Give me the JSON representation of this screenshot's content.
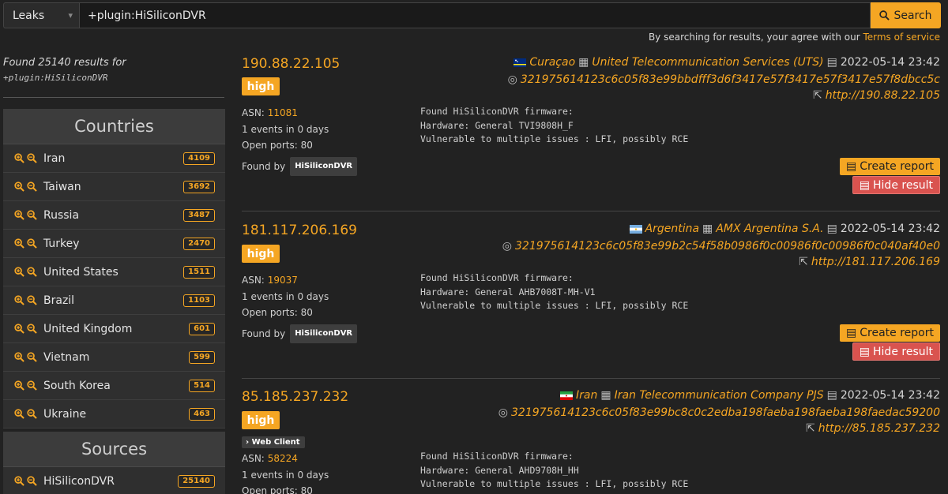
{
  "search": {
    "category": "Leaks",
    "query": "+plugin:HiSiliconDVR",
    "button_label": "Search",
    "terms_prefix": "By searching for results, your agree with our",
    "terms_link": "Terms of service"
  },
  "summary": {
    "found_text": "Found 25140 results for",
    "query": "+plugin:HiSiliconDVR"
  },
  "countries": {
    "title": "Countries",
    "items": [
      {
        "label": "Iran",
        "count": "4109"
      },
      {
        "label": "Taiwan",
        "count": "3692"
      },
      {
        "label": "Russia",
        "count": "3487"
      },
      {
        "label": "Turkey",
        "count": "2470"
      },
      {
        "label": "United States",
        "count": "1511"
      },
      {
        "label": "Brazil",
        "count": "1103"
      },
      {
        "label": "United Kingdom",
        "count": "601"
      },
      {
        "label": "Vietnam",
        "count": "599"
      },
      {
        "label": "South Korea",
        "count": "514"
      },
      {
        "label": "Ukraine",
        "count": "463"
      }
    ]
  },
  "sources": {
    "title": "Sources",
    "items": [
      {
        "label": "HiSiliconDVR",
        "count": "25140"
      }
    ]
  },
  "results": [
    {
      "ip": "190.88.22.105",
      "severity": "high",
      "asn_label": "ASN:",
      "asn": "11081",
      "events": "1 events in 0 days",
      "ports": "Open ports: 80",
      "found_by_label": "Found by",
      "found_by": "HiSiliconDVR",
      "country": "Curaçao",
      "org": "United Telecommunication Services (UTS)",
      "date": "2022-05-14 23:42",
      "hash": "321975614123c6c05f83e99bbdfff3d6f3417e57f3417e57f3417e57f8dbcc5c",
      "url": "http://190.88.22.105",
      "desc_line1": "Found HiSiliconDVR firmware:",
      "desc_line2": "Hardware: General TVI9808H_F",
      "desc_line3": "Vulnerable to multiple issues : LFI, possibly RCE",
      "report_label": "Create report",
      "hide_label": "Hide result"
    },
    {
      "ip": "181.117.206.169",
      "severity": "high",
      "asn_label": "ASN:",
      "asn": "19037",
      "events": "1 events in 0 days",
      "ports": "Open ports: 80",
      "found_by_label": "Found by",
      "found_by": "HiSiliconDVR",
      "country": "Argentina",
      "org": "AMX Argentina S.A.",
      "date": "2022-05-14 23:42",
      "hash": "321975614123c6c05f83e99b2c54f58b0986f0c00986f0c00986f0c040af40e0",
      "url": "http://181.117.206.169",
      "desc_line1": "Found HiSiliconDVR firmware:",
      "desc_line2": "Hardware: General AHB7008T-MH-V1",
      "desc_line3": "Vulnerable to multiple issues : LFI, possibly RCE",
      "report_label": "Create report",
      "hide_label": "Hide result"
    },
    {
      "ip": "85.185.237.232",
      "severity": "high",
      "web_client": "Web Client",
      "asn_label": "ASN:",
      "asn": "58224",
      "events": "1 events in 0 days",
      "ports": "Open ports: 80",
      "country": "Iran",
      "org": "Iran Telecommunication Company PJS",
      "date": "2022-05-14 23:42",
      "hash": "321975614123c6c05f83e99bc8c0c2edba198faeba198faeba198faedac59200",
      "url": "http://85.185.237.232",
      "desc_line1": "Found HiSiliconDVR firmware:",
      "desc_line2": "Hardware: General AHD9708H_HH",
      "desc_line3": "Vulnerable to multiple issues : LFI, possibly RCE"
    }
  ],
  "icons": {
    "zoom_in": "zoom-in-icon",
    "zoom_out": "zoom-out-icon",
    "building": "building-icon",
    "calendar": "calendar-icon",
    "fingerprint": "fingerprint-icon",
    "external_link": "external-link-icon",
    "file": "file-icon",
    "chevron_right": "chevron-right-icon",
    "search": "search-icon"
  },
  "colors": {
    "accent": "#f5a623",
    "danger": "#d9534f",
    "background": "#222222"
  }
}
